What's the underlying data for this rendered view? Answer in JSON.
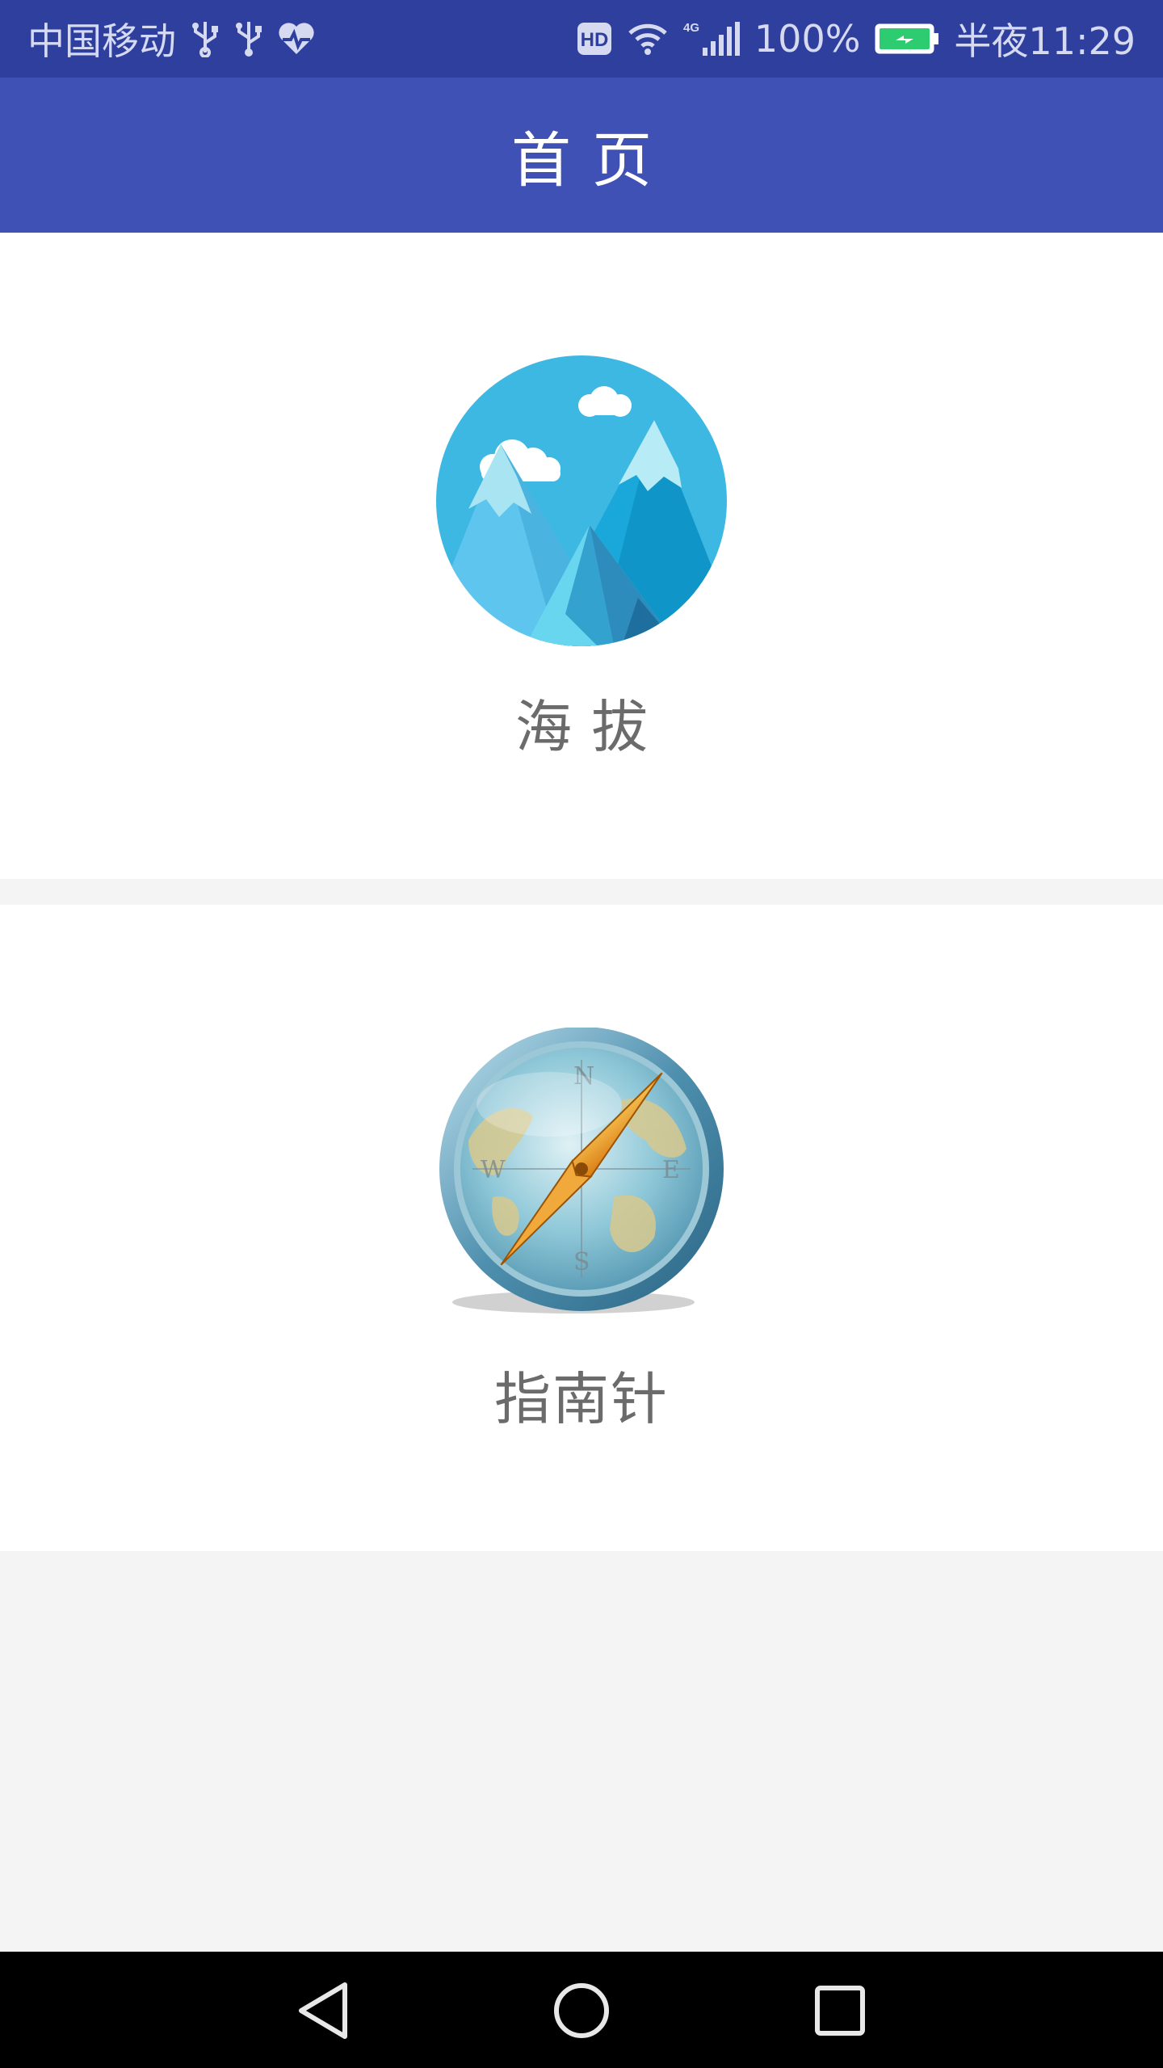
{
  "status_bar": {
    "carrier": "中国移动",
    "network_badge": "HD",
    "network_type": "4G",
    "battery_percent": "100%",
    "time": "半夜11:29",
    "icons": [
      "usb-icon",
      "usb-icon",
      "health-icon",
      "hd-icon",
      "wifi-icon",
      "cell-signal-icon",
      "battery-charging-icon"
    ],
    "colors": {
      "background": "#2f3f9e",
      "battery_fill": "#2ecc71"
    }
  },
  "app_bar": {
    "title": "首页",
    "color": "#3f51b5"
  },
  "menu": {
    "items": [
      {
        "label": "海拔",
        "icon": "mountain-icon"
      },
      {
        "label": "指南针",
        "icon": "compass-icon"
      }
    ]
  },
  "nav_bar": {
    "buttons": [
      "back-icon",
      "home-icon",
      "recent-apps-icon"
    ]
  }
}
